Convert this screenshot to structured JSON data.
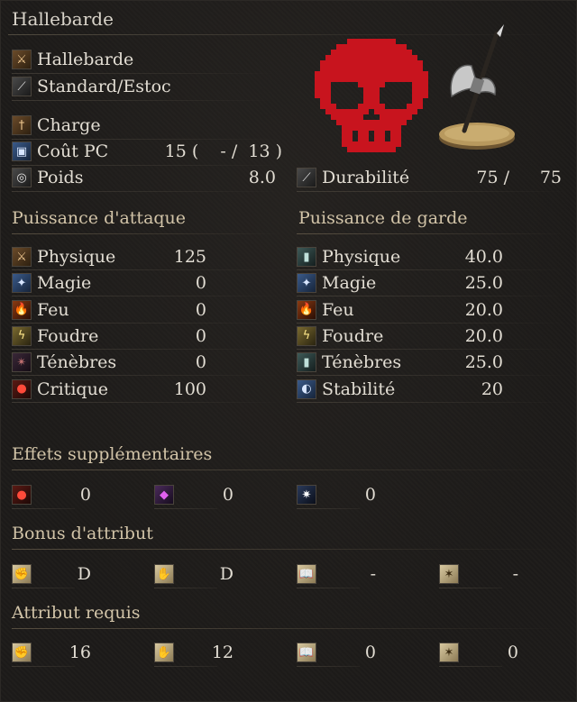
{
  "weapon": {
    "name": "Hallebarde",
    "type_name": "Hallebarde",
    "attack_type": "Standard/Estoc",
    "skill": "Charge",
    "fp_label": "Coût PC",
    "fp_value": "15 (    - /  13 )",
    "weight_label": "Poids",
    "weight_value": "8.0",
    "durability_label": "Durabilité",
    "durability_current": "75 /",
    "durability_max": "75"
  },
  "attack": {
    "heading": "Puissance d'attaque",
    "rows": [
      {
        "label": "Physique",
        "value": "125",
        "icon": "sword-icon",
        "color": "brown",
        "glyph": "⚔"
      },
      {
        "label": "Magie",
        "value": "0",
        "icon": "magic-icon",
        "color": "blue",
        "glyph": "✦"
      },
      {
        "label": "Feu",
        "value": "0",
        "icon": "fire-icon",
        "color": "fire",
        "glyph": "🔥"
      },
      {
        "label": "Foudre",
        "value": "0",
        "icon": "lightning-icon",
        "color": "gold",
        "glyph": "ϟ"
      },
      {
        "label": "Ténèbres",
        "value": "0",
        "icon": "dark-icon",
        "color": "dark",
        "glyph": "✴"
      },
      {
        "label": "Critique",
        "value": "100",
        "icon": "critical-icon",
        "color": "red",
        "glyph": "●"
      }
    ]
  },
  "guard": {
    "heading": "Puissance de garde",
    "rows": [
      {
        "label": "Physique",
        "value": "40.0",
        "icon": "shield-physical-icon",
        "color": "teal",
        "glyph": "▮"
      },
      {
        "label": "Magie",
        "value": "25.0",
        "icon": "shield-magic-icon",
        "color": "blue",
        "glyph": "✦"
      },
      {
        "label": "Feu",
        "value": "20.0",
        "icon": "shield-fire-icon",
        "color": "fire",
        "glyph": "🔥"
      },
      {
        "label": "Foudre",
        "value": "20.0",
        "icon": "shield-lightning-icon",
        "color": "gold",
        "glyph": "ϟ"
      },
      {
        "label": "Ténèbres",
        "value": "25.0",
        "icon": "shield-dark-icon",
        "color": "teal",
        "glyph": "▮"
      },
      {
        "label": "Stabilité",
        "value": "20",
        "icon": "stability-icon",
        "color": "blue",
        "glyph": "◐"
      }
    ]
  },
  "effects": {
    "heading": "Effets supplémentaires",
    "items": [
      {
        "value": "0",
        "icon": "bleed-icon",
        "color": "red",
        "glyph": "●"
      },
      {
        "value": "0",
        "icon": "poison-icon",
        "color": "purple",
        "glyph": "◆"
      },
      {
        "value": "0",
        "icon": "frost-icon",
        "color": "light",
        "glyph": "✷"
      }
    ]
  },
  "scaling": {
    "heading": "Bonus d'attribut",
    "items": [
      {
        "value": "D",
        "icon": "strength-icon",
        "glyph": "✊"
      },
      {
        "value": "D",
        "icon": "dexterity-icon",
        "glyph": "✋"
      },
      {
        "value": "-",
        "icon": "intelligence-icon",
        "glyph": "📖"
      },
      {
        "value": "-",
        "icon": "faith-icon",
        "glyph": "✶"
      }
    ]
  },
  "requirements": {
    "heading": "Attribut requis",
    "items": [
      {
        "value": "16",
        "icon": "strength-icon",
        "glyph": "✊"
      },
      {
        "value": "12",
        "icon": "dexterity-icon",
        "glyph": "✋"
      },
      {
        "value": "0",
        "icon": "intelligence-icon",
        "glyph": "📖"
      },
      {
        "value": "0",
        "icon": "faith-icon",
        "glyph": "✶"
      }
    ]
  },
  "colors": {
    "skull": "#c8141e",
    "text": "#e2ddd3",
    "heading": "#d2c4a8"
  }
}
